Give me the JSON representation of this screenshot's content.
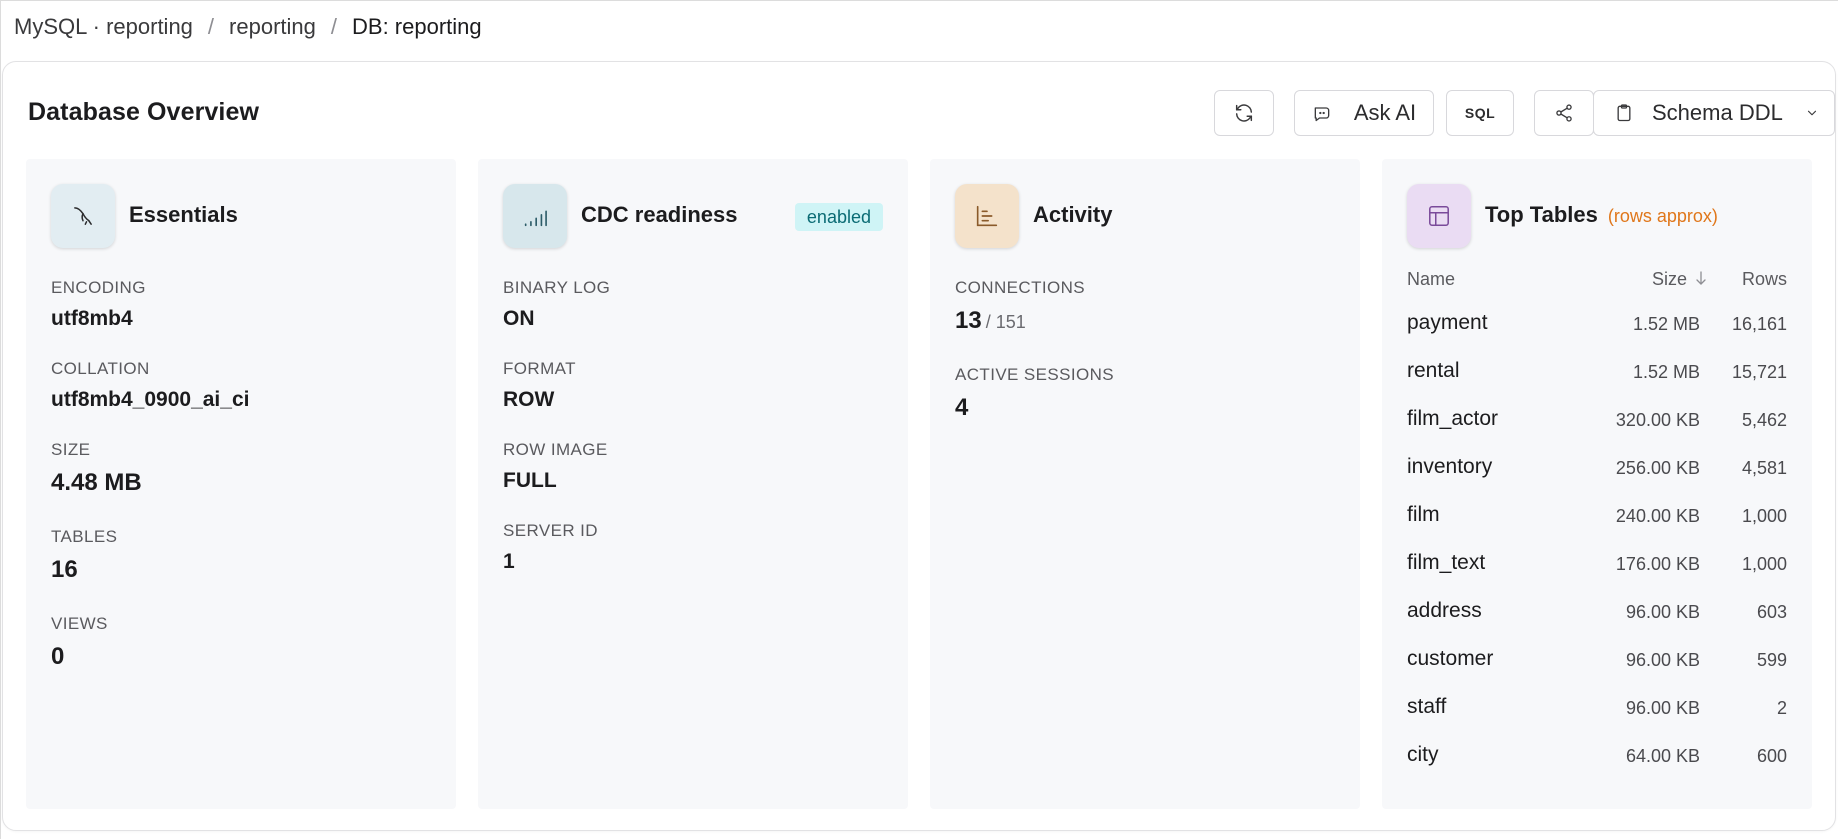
{
  "breadcrumb": {
    "items": [
      "MySQL · reporting",
      "reporting",
      "DB: reporting"
    ]
  },
  "header": {
    "title": "Database Overview",
    "toolbar": {
      "refresh_icon": "refresh-icon",
      "ask_ai_label": "Ask AI",
      "sql_label": "SQL",
      "share_icon": "share-icon",
      "schema_label": "Schema DDL"
    }
  },
  "essentials": {
    "title": "Essentials",
    "icon": "mysql-dolphin-icon",
    "fields": [
      {
        "label": "ENCODING",
        "value": "utf8mb4"
      },
      {
        "label": "COLLATION",
        "value": "utf8mb4_0900_ai_ci"
      },
      {
        "label": "SIZE",
        "value": "4.48 MB"
      },
      {
        "label": "TABLES",
        "value": "16"
      },
      {
        "label": "VIEWS",
        "value": "0"
      }
    ]
  },
  "cdc": {
    "title": "CDC readiness",
    "icon": "signal-bars-icon",
    "badge": "enabled",
    "fields": [
      {
        "label": "BINARY LOG",
        "value": "ON"
      },
      {
        "label": "FORMAT",
        "value": "ROW"
      },
      {
        "label": "ROW IMAGE",
        "value": "FULL"
      },
      {
        "label": "SERVER ID",
        "value": "1"
      }
    ]
  },
  "activity": {
    "title": "Activity",
    "icon": "bar-chart-icon",
    "connections_label": "CONNECTIONS",
    "connections_value": "13",
    "connections_max": "/ 151",
    "sessions_label": "ACTIVE SESSIONS",
    "sessions_value": "4"
  },
  "top_tables": {
    "title": "Top Tables",
    "note": "(rows approx)",
    "icon": "table-icon",
    "columns": {
      "name": "Name",
      "size": "Size",
      "rows": "Rows"
    },
    "sort_icon": "arrow-down-icon",
    "rows": [
      {
        "name": "payment",
        "size": "1.52 MB",
        "rows": "16,161"
      },
      {
        "name": "rental",
        "size": "1.52 MB",
        "rows": "15,721"
      },
      {
        "name": "film_actor",
        "size": "320.00 KB",
        "rows": "5,462"
      },
      {
        "name": "inventory",
        "size": "256.00 KB",
        "rows": "4,581"
      },
      {
        "name": "film",
        "size": "240.00 KB",
        "rows": "1,000"
      },
      {
        "name": "film_text",
        "size": "176.00 KB",
        "rows": "1,000"
      },
      {
        "name": "address",
        "size": "96.00 KB",
        "rows": "603"
      },
      {
        "name": "customer",
        "size": "96.00 KB",
        "rows": "599"
      },
      {
        "name": "staff",
        "size": "96.00 KB",
        "rows": "2"
      },
      {
        "name": "city",
        "size": "64.00 KB",
        "rows": "600"
      }
    ]
  },
  "colors": {
    "essentials_tile": "#e2edf2",
    "cdc_tile": "#d7e7ec",
    "activity_tile": "#f4e2cb",
    "tables_tile": "#eadcf3",
    "badge_bg": "#cff4f6",
    "note_orange": "#e0771b"
  }
}
